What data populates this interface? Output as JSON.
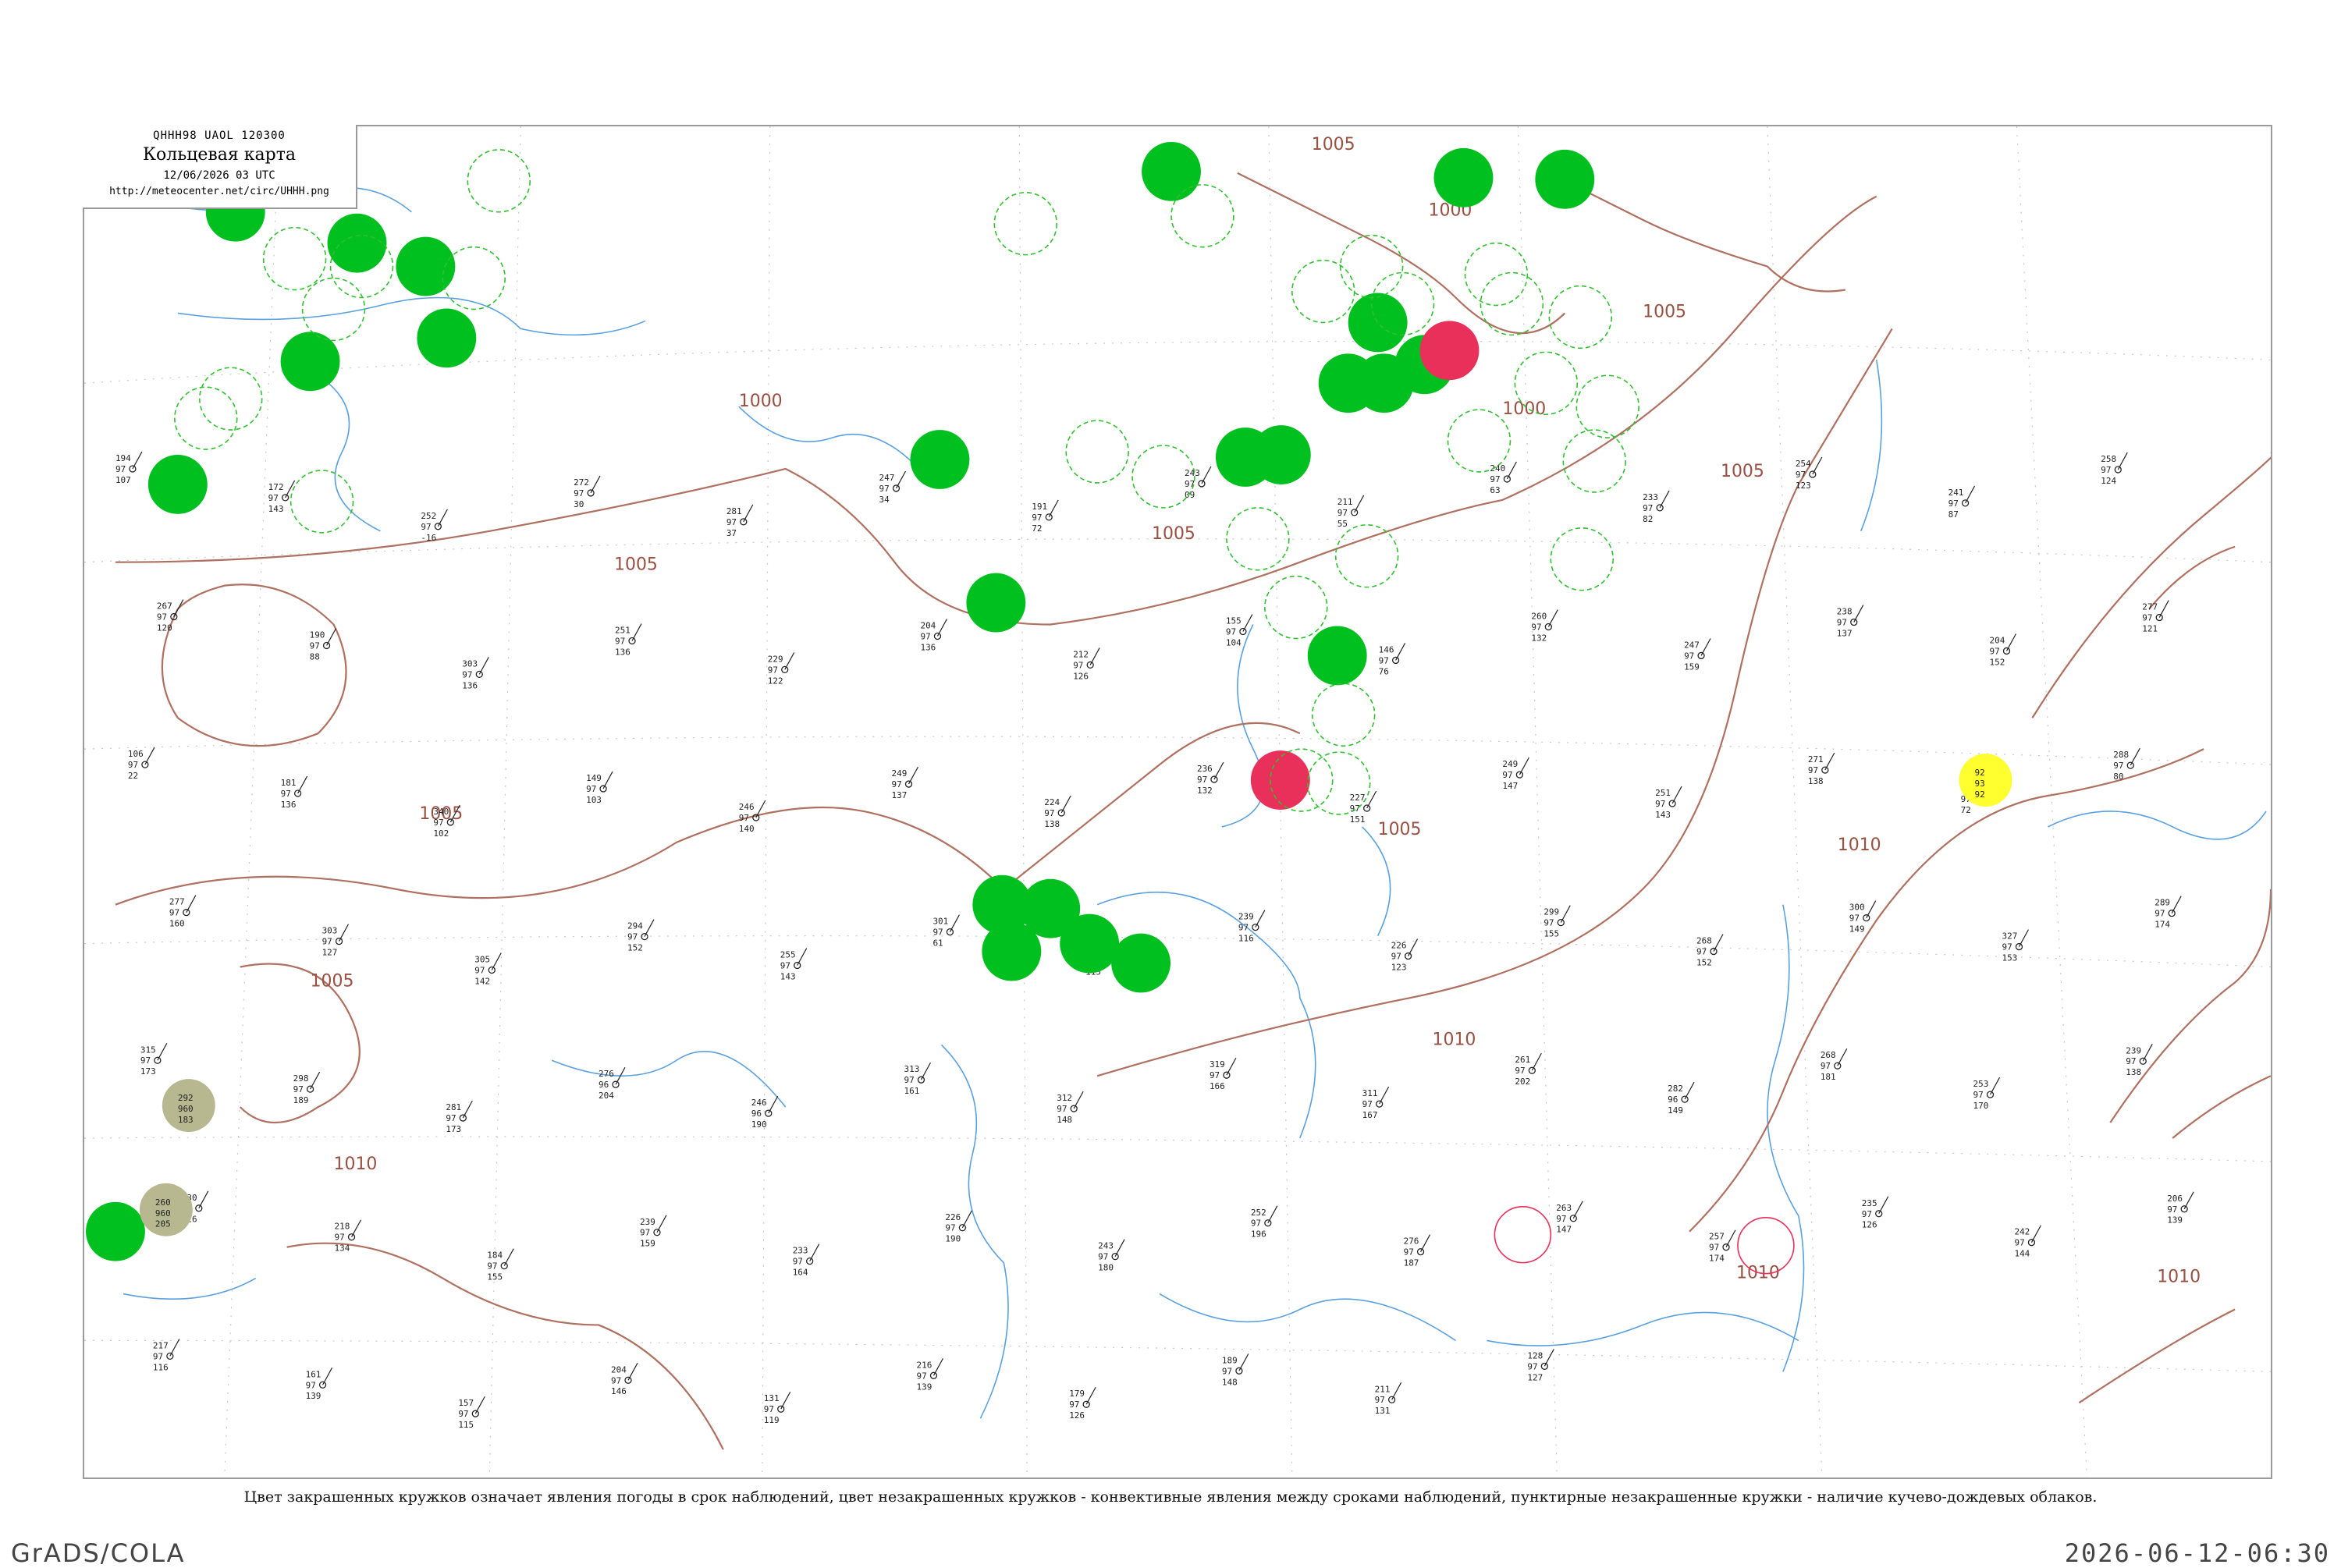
{
  "header": {
    "code_line": "QHHH98  UAOL  120300",
    "title": "Кольцевая карта",
    "time": "12/06/2026 03 UTC",
    "url": "http://meteocenter.net/circ/UHHH.png"
  },
  "caption": "Цвет закрашенных кружков означает явления погоды в срок наблюдений, цвет незакрашенных кружков - конвективные явления между сроками наблюдений, пунктирные незакрашенные кружки - наличие кучево-дождевых облаков.",
  "footer": {
    "left": "GrADS/COLA",
    "right": "2026-06-12-06:30"
  },
  "colors": {
    "isobar": "#b07060",
    "river": "#5aa0e0",
    "grid": "#c8c8c8",
    "rain": "#00c020",
    "thunder": "#e8305a",
    "snow_or_other": "#ffff30",
    "fog": "#b8b890",
    "cb_dashed": "#30c030"
  },
  "isobar_labels": [
    {
      "text": "1005"
    },
    {
      "text": "1000"
    },
    {
      "text": "1005"
    },
    {
      "text": "1005"
    },
    {
      "text": "1000"
    },
    {
      "text": "1005"
    },
    {
      "text": "1000"
    },
    {
      "text": "1005"
    },
    {
      "text": "1005"
    },
    {
      "text": "1005"
    },
    {
      "text": "1010"
    },
    {
      "text": "1010"
    },
    {
      "text": "1010"
    },
    {
      "text": "1010"
    },
    {
      "text": "1005"
    },
    {
      "text": "1010"
    }
  ],
  "stations": [
    {
      "t": "194",
      "v": "97",
      "d": "107"
    },
    {
      "t": "172",
      "v": "97",
      "d": "143"
    },
    {
      "t": "252",
      "v": "97",
      "d": "-16"
    },
    {
      "t": "272",
      "v": "97",
      "d": "30"
    },
    {
      "t": "281",
      "v": "97",
      "d": "37"
    },
    {
      "t": "247",
      "v": "97",
      "d": "34"
    },
    {
      "t": "191",
      "v": "97",
      "d": "72"
    },
    {
      "t": "243",
      "v": "97",
      "d": "09"
    },
    {
      "t": "211",
      "v": "97",
      "d": "55"
    },
    {
      "t": "240",
      "v": "97",
      "d": "63"
    },
    {
      "t": "233",
      "v": "97",
      "d": "82"
    },
    {
      "t": "254",
      "v": "97",
      "d": "123"
    },
    {
      "t": "241",
      "v": "97",
      "d": "87"
    },
    {
      "t": "258",
      "v": "97",
      "d": "124"
    },
    {
      "t": "267",
      "v": "97",
      "d": "120"
    },
    {
      "t": "190",
      "v": "97",
      "d": "88"
    },
    {
      "t": "303",
      "v": "97",
      "d": "136"
    },
    {
      "t": "251",
      "v": "97",
      "d": "136"
    },
    {
      "t": "229",
      "v": "97",
      "d": "122"
    },
    {
      "t": "204",
      "v": "97",
      "d": "136"
    },
    {
      "t": "212",
      "v": "97",
      "d": "126"
    },
    {
      "t": "155",
      "v": "97",
      "d": "104"
    },
    {
      "t": "146",
      "v": "97",
      "d": "76"
    },
    {
      "t": "260",
      "v": "97",
      "d": "132"
    },
    {
      "t": "247",
      "v": "97",
      "d": "159"
    },
    {
      "t": "238",
      "v": "97",
      "d": "137"
    },
    {
      "t": "204",
      "v": "97",
      "d": "152"
    },
    {
      "t": "277",
      "v": "97",
      "d": "121"
    },
    {
      "t": "106",
      "v": "97",
      "d": "22"
    },
    {
      "t": "181",
      "v": "97",
      "d": "136"
    },
    {
      "t": "340",
      "v": "97",
      "d": "102"
    },
    {
      "t": "149",
      "v": "97",
      "d": "103"
    },
    {
      "t": "246",
      "v": "97",
      "d": "140"
    },
    {
      "t": "249",
      "v": "97",
      "d": "137"
    },
    {
      "t": "224",
      "v": "97",
      "d": "138"
    },
    {
      "t": "236",
      "v": "97",
      "d": "132"
    },
    {
      "t": "227",
      "v": "97",
      "d": "151"
    },
    {
      "t": "249",
      "v": "97",
      "d": "147"
    },
    {
      "t": "251",
      "v": "97",
      "d": "143"
    },
    {
      "t": "271",
      "v": "97",
      "d": "138"
    },
    {
      "t": "286",
      "v": "97",
      "d": "72"
    },
    {
      "t": "288",
      "v": "97",
      "d": "80"
    },
    {
      "t": "277",
      "v": "97",
      "d": "160"
    },
    {
      "t": "303",
      "v": "97",
      "d": "127"
    },
    {
      "t": "305",
      "v": "97",
      "d": "142"
    },
    {
      "t": "294",
      "v": "97",
      "d": "152"
    },
    {
      "t": "255",
      "v": "97",
      "d": "143"
    },
    {
      "t": "301",
      "v": "97",
      "d": "61"
    },
    {
      "t": "275",
      "v": "97",
      "d": "115"
    },
    {
      "t": "239",
      "v": "97",
      "d": "116"
    },
    {
      "t": "226",
      "v": "97",
      "d": "123"
    },
    {
      "t": "299",
      "v": "97",
      "d": "155"
    },
    {
      "t": "268",
      "v": "97",
      "d": "152"
    },
    {
      "t": "300",
      "v": "97",
      "d": "149"
    },
    {
      "t": "327",
      "v": "97",
      "d": "153"
    },
    {
      "t": "289",
      "v": "97",
      "d": "174"
    },
    {
      "t": "315",
      "v": "97",
      "d": "173"
    },
    {
      "t": "298",
      "v": "97",
      "d": "189"
    },
    {
      "t": "281",
      "v": "97",
      "d": "173"
    },
    {
      "t": "276",
      "v": "96",
      "d": "204"
    },
    {
      "t": "246",
      "v": "96",
      "d": "190"
    },
    {
      "t": "313",
      "v": "97",
      "d": "161"
    },
    {
      "t": "312",
      "v": "97",
      "d": "148"
    },
    {
      "t": "319",
      "v": "97",
      "d": "166"
    },
    {
      "t": "311",
      "v": "97",
      "d": "167"
    },
    {
      "t": "261",
      "v": "97",
      "d": "202"
    },
    {
      "t": "282",
      "v": "96",
      "d": "149"
    },
    {
      "t": "268",
      "v": "97",
      "d": "181"
    },
    {
      "t": "253",
      "v": "97",
      "d": "170"
    },
    {
      "t": "239",
      "v": "97",
      "d": "138"
    },
    {
      "t": "230",
      "v": "97",
      "d": "126"
    },
    {
      "t": "218",
      "v": "97",
      "d": "134"
    },
    {
      "t": "184",
      "v": "97",
      "d": "155"
    },
    {
      "t": "239",
      "v": "97",
      "d": "159"
    },
    {
      "t": "233",
      "v": "97",
      "d": "164"
    },
    {
      "t": "226",
      "v": "97",
      "d": "190"
    },
    {
      "t": "243",
      "v": "97",
      "d": "180"
    },
    {
      "t": "252",
      "v": "97",
      "d": "196"
    },
    {
      "t": "276",
      "v": "97",
      "d": "187"
    },
    {
      "t": "263",
      "v": "97",
      "d": "147"
    },
    {
      "t": "257",
      "v": "97",
      "d": "174"
    },
    {
      "t": "235",
      "v": "97",
      "d": "126"
    },
    {
      "t": "242",
      "v": "97",
      "d": "144"
    },
    {
      "t": "206",
      "v": "97",
      "d": "139"
    },
    {
      "t": "217",
      "v": "97",
      "d": "116"
    },
    {
      "t": "161",
      "v": "97",
      "d": "139"
    },
    {
      "t": "157",
      "v": "97",
      "d": "115"
    },
    {
      "t": "204",
      "v": "97",
      "d": "146"
    },
    {
      "t": "131",
      "v": "97",
      "d": "119"
    },
    {
      "t": "216",
      "v": "97",
      "d": "139"
    },
    {
      "t": "179",
      "v": "97",
      "d": "126"
    },
    {
      "t": "189",
      "v": "97",
      "d": "148"
    },
    {
      "t": "211",
      "v": "97",
      "d": "131"
    },
    {
      "t": "128",
      "v": "97",
      "d": "127"
    }
  ],
  "weather_circles": [
    {
      "kind": "rain",
      "t": "",
      "v": "",
      "d": ""
    },
    {
      "kind": "rain",
      "t": "",
      "v": "",
      "d": ""
    },
    {
      "kind": "rain",
      "t": "",
      "v": "",
      "d": ""
    },
    {
      "kind": "rain",
      "t": "",
      "v": "",
      "d": ""
    },
    {
      "kind": "rain",
      "t": "",
      "v": "",
      "d": ""
    },
    {
      "kind": "rain",
      "t": "",
      "v": "",
      "d": ""
    },
    {
      "kind": "rain",
      "t": "",
      "v": "",
      "d": ""
    },
    {
      "kind": "rain",
      "t": "",
      "v": "",
      "d": ""
    },
    {
      "kind": "rain",
      "t": "",
      "v": "",
      "d": ""
    },
    {
      "kind": "rain",
      "t": "",
      "v": "",
      "d": ""
    },
    {
      "kind": "rain",
      "t": "",
      "v": "",
      "d": ""
    },
    {
      "kind": "rain",
      "t": "",
      "v": "",
      "d": ""
    },
    {
      "kind": "rain",
      "t": "",
      "v": "",
      "d": ""
    },
    {
      "kind": "rain",
      "t": "",
      "v": "",
      "d": ""
    },
    {
      "kind": "rain",
      "t": "",
      "v": "",
      "d": ""
    },
    {
      "kind": "rain",
      "t": "",
      "v": "",
      "d": ""
    },
    {
      "kind": "rain",
      "t": "",
      "v": "",
      "d": ""
    },
    {
      "kind": "rain",
      "t": "",
      "v": "",
      "d": ""
    },
    {
      "kind": "rain",
      "t": "",
      "v": "",
      "d": ""
    },
    {
      "kind": "rain",
      "t": "",
      "v": "",
      "d": ""
    },
    {
      "kind": "rain",
      "t": "",
      "v": "",
      "d": ""
    },
    {
      "kind": "rain",
      "t": "",
      "v": "",
      "d": ""
    },
    {
      "kind": "rain",
      "t": "",
      "v": "",
      "d": ""
    },
    {
      "kind": "rain",
      "t": "",
      "v": "",
      "d": ""
    },
    {
      "kind": "rain",
      "t": "",
      "v": "",
      "d": ""
    },
    {
      "kind": "thunder",
      "t": "",
      "v": "",
      "d": ""
    },
    {
      "kind": "thunder",
      "t": "",
      "v": "",
      "d": ""
    },
    {
      "kind": "snow_or_other",
      "t": "92",
      "v": "93",
      "d": "92"
    },
    {
      "kind": "fog",
      "t": "292",
      "v": "960",
      "d": "183"
    },
    {
      "kind": "fog",
      "t": "260",
      "v": "960",
      "d": "205"
    }
  ],
  "cb_circles": [
    {
      "kind": "cb"
    },
    {
      "kind": "cb"
    },
    {
      "kind": "cb"
    },
    {
      "kind": "cb"
    },
    {
      "kind": "cb"
    },
    {
      "kind": "cb"
    },
    {
      "kind": "cb"
    },
    {
      "kind": "cb"
    },
    {
      "kind": "cb"
    },
    {
      "kind": "cb"
    },
    {
      "kind": "cb"
    },
    {
      "kind": "cb"
    },
    {
      "kind": "cb"
    },
    {
      "kind": "cb"
    },
    {
      "kind": "cb"
    },
    {
      "kind": "cb"
    },
    {
      "kind": "cb"
    },
    {
      "kind": "cb"
    },
    {
      "kind": "cb"
    },
    {
      "kind": "cb"
    },
    {
      "kind": "cb"
    },
    {
      "kind": "cb"
    },
    {
      "kind": "cb"
    },
    {
      "kind": "cb"
    },
    {
      "kind": "cb"
    },
    {
      "kind": "cb"
    },
    {
      "kind": "cb"
    },
    {
      "kind": "cb"
    },
    {
      "kind": "cb"
    }
  ],
  "thunder_ring_circles": [
    {
      "kind": "thunder_ring"
    },
    {
      "kind": "thunder_ring"
    }
  ]
}
